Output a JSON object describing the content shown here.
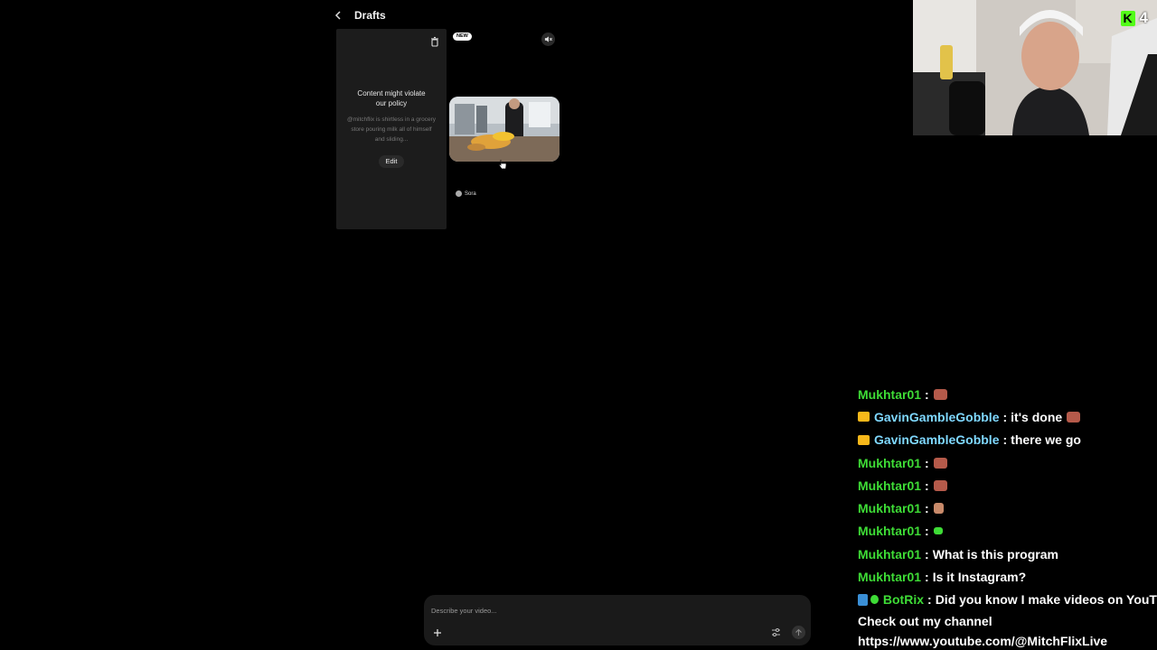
{
  "drafts": {
    "title": "Drafts"
  },
  "policy_card": {
    "title": "Content might violate our policy",
    "description": "@mitchflix is shirtless in a grocery store pouring milk all of himself and sliding...",
    "edit_label": "Edit"
  },
  "video_card": {
    "badge": "NEW",
    "source_label": "Sora"
  },
  "stream": {
    "platform_icon": "kick-logo",
    "viewer_count": "4",
    "accent_color": "#53fc18"
  },
  "chat": {
    "messages": [
      {
        "user": "Mukhtar01",
        "sep": ":",
        "text": "",
        "emote": "#b55a4a"
      },
      {
        "user": "GavinGambleGobble",
        "sep": ":",
        "text": "it's done",
        "emote": "#b55a4a",
        "badge": "crown-icon"
      },
      {
        "user": "GavinGambleGobble",
        "sep": ":",
        "text": "there we go",
        "badge": "crown-icon"
      },
      {
        "user": "Mukhtar01",
        "sep": ":",
        "text": "",
        "emote": "#b55a4a"
      },
      {
        "user": "Mukhtar01",
        "sep": ":",
        "text": "",
        "emote": "#b55a4a"
      },
      {
        "user": "Mukhtar01",
        "sep": ":",
        "text": "",
        "emote": "#c98a6a"
      },
      {
        "user": "Mukhtar01",
        "sep": ":",
        "text": "",
        "emote": "#3edc36"
      },
      {
        "user": "Mukhtar01",
        "sep": ":",
        "text": "What is this program"
      },
      {
        "user": "Mukhtar01",
        "sep": ":",
        "text": "Is it Instagram?"
      },
      {
        "user": "BotRix",
        "sep": ":",
        "text": "Did you know I make videos on YouT",
        "badge": "bot"
      }
    ],
    "continuation": [
      "Check out my channel",
      "https://www.youtube.com/@MitchFlixLive"
    ]
  },
  "prompt": {
    "placeholder": "Describe your video..."
  }
}
